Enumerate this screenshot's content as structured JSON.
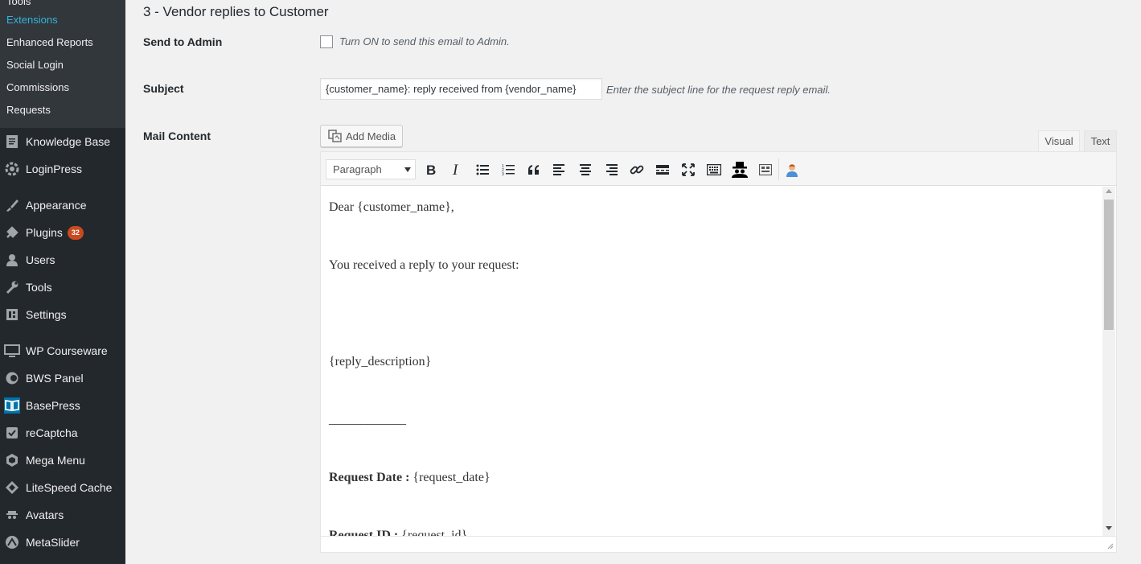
{
  "sidebar": {
    "submenu": [
      {
        "label": "Tools",
        "current": false
      },
      {
        "label": "Extensions",
        "current": true
      },
      {
        "label": "Enhanced Reports",
        "current": false
      },
      {
        "label": "Social Login",
        "current": false
      },
      {
        "label": "Commissions",
        "current": false
      },
      {
        "label": "Requests",
        "current": false
      }
    ],
    "menu": [
      {
        "label": "Knowledge Base",
        "icon": "document-icon"
      },
      {
        "label": "LoginPress",
        "icon": "loginpress-gear-icon"
      },
      {
        "label": "Appearance",
        "icon": "paintbrush-icon"
      },
      {
        "label": "Plugins",
        "icon": "plugin-icon",
        "badge": "32"
      },
      {
        "label": "Users",
        "icon": "user-icon"
      },
      {
        "label": "Tools",
        "icon": "wrench-icon"
      },
      {
        "label": "Settings",
        "icon": "settings-icon"
      },
      {
        "label": "WP Courseware",
        "icon": "monitor-icon"
      },
      {
        "label": "BWS Panel",
        "icon": "bws-icon"
      },
      {
        "label": "BasePress",
        "icon": "book-icon"
      },
      {
        "label": "reCaptcha",
        "icon": "checkbox-icon"
      },
      {
        "label": "Mega Menu",
        "icon": "mega-menu-icon"
      },
      {
        "label": "LiteSpeed Cache",
        "icon": "diamond-icon"
      },
      {
        "label": "Avatars",
        "icon": "spy-icon"
      },
      {
        "label": "MetaSlider",
        "icon": "metaslider-icon"
      }
    ]
  },
  "section": {
    "title": "3 - Vendor replies to Customer"
  },
  "fields": {
    "send_to_admin": {
      "label": "Send to Admin",
      "description": "Turn ON to send this email to Admin.",
      "checked": false
    },
    "subject": {
      "label": "Subject",
      "value": "{customer_name}: reply received from {vendor_name}",
      "description": "Enter the subject line for the request reply email."
    },
    "mail_content": {
      "label": "Mail Content"
    }
  },
  "editor": {
    "add_media_label": "Add Media",
    "tabs": {
      "visual": "Visual",
      "text": "Text"
    },
    "active_tab": "Visual",
    "format_select": "Paragraph",
    "toolbar_icons": [
      "bold-icon",
      "italic-icon",
      "bullet-list-icon",
      "numbered-list-icon",
      "blockquote-icon",
      "align-left-icon",
      "align-center-icon",
      "align-right-icon",
      "link-icon",
      "read-more-icon",
      "fullscreen-icon",
      "keyboard-icon",
      "incognito-icon",
      "toolbar-toggle-icon",
      "user-avatar-icon"
    ],
    "content": {
      "line1": "Dear {customer_name},",
      "line2": "You received a reply to your request:",
      "line3": "{reply_description}",
      "line4": "____________",
      "line5_label": "Request Date :",
      "line5_value": "{request_date}",
      "line6_label": "Request ID :",
      "line6_value": "{request_id}"
    }
  },
  "colors": {
    "sidebar_bg": "#23282d",
    "submenu_bg": "#32373c",
    "current_link": "#33b3db",
    "badge": "#ca4a1f"
  }
}
